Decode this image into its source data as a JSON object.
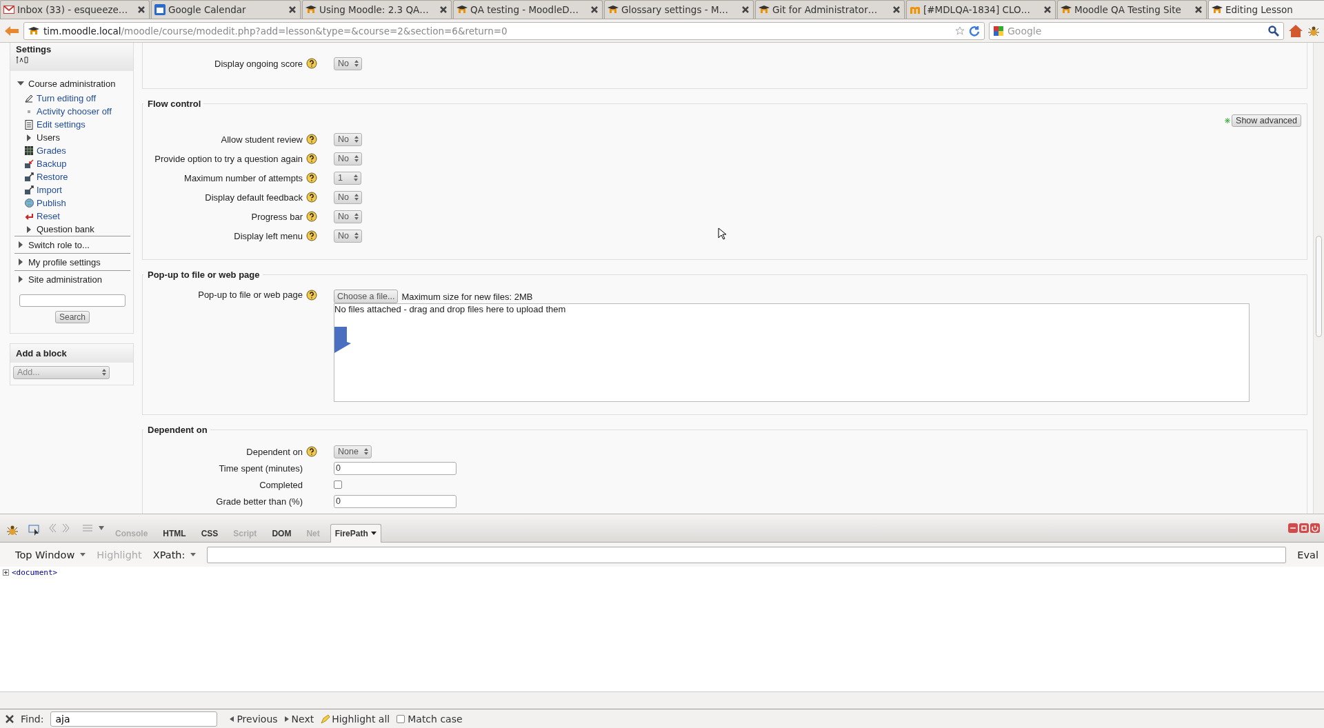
{
  "browser": {
    "tabs": [
      {
        "title": "Inbox (33) - esqueeze…",
        "kind": "mail",
        "selected": false
      },
      {
        "title": "Google Calendar",
        "kind": "calendar",
        "selected": false
      },
      {
        "title": "Using Moodle: 2.3 QA…",
        "kind": "moodle",
        "selected": false
      },
      {
        "title": "QA testing - MoodleD…",
        "kind": "moodle",
        "selected": false
      },
      {
        "title": "Glossary settings - M…",
        "kind": "moodle",
        "selected": false
      },
      {
        "title": "Git for Administrator…",
        "kind": "moodle",
        "selected": false
      },
      {
        "title": "[#MDLQA-1834] CLO…",
        "kind": "m",
        "selected": false
      },
      {
        "title": "Moodle QA Testing Site",
        "kind": "moodle",
        "selected": false
      },
      {
        "title": "Editing Lesson",
        "kind": "moodle",
        "selected": true
      }
    ],
    "url": {
      "host": "tim.moodle.local",
      "path": "/moodle/course/modedit.php?add=lesson&type=&course=2&section=6&return=0"
    },
    "search": {
      "placeholder": "Google"
    }
  },
  "sidebar": {
    "settings": {
      "title": "Settings",
      "tree": [
        {
          "label": "Course administration",
          "expanded": true,
          "children": [
            {
              "label": "Turn editing off",
              "kind": "edit"
            },
            {
              "label": "Activity chooser off",
              "kind": "dot"
            },
            {
              "label": "Edit settings",
              "kind": "doc"
            },
            {
              "label": "Users",
              "kind": "folder",
              "expanded": false
            },
            {
              "label": "Grades",
              "kind": "grid"
            },
            {
              "label": "Backup",
              "kind": "backup"
            },
            {
              "label": "Restore",
              "kind": "restore"
            },
            {
              "label": "Import",
              "kind": "restore"
            },
            {
              "label": "Publish",
              "kind": "globe"
            },
            {
              "label": "Reset",
              "kind": "reset"
            },
            {
              "label": "Question bank",
              "kind": "folder",
              "expanded": false
            }
          ]
        },
        {
          "label": "Switch role to...",
          "expanded": false
        },
        {
          "label": "My profile settings",
          "expanded": false
        },
        {
          "label": "Site administration",
          "expanded": false
        }
      ],
      "search_button": "Search"
    },
    "add_block": {
      "title": "Add a block",
      "select": "Add..."
    }
  },
  "form": {
    "sections": [
      {
        "rows": [
          {
            "label": "Display ongoing score",
            "help": true,
            "kind": "select",
            "value": "No"
          }
        ]
      },
      {
        "legend": "Flow control",
        "advanced_button": "Show advanced",
        "rows": [
          {
            "label": "Allow student review",
            "help": true,
            "kind": "select",
            "value": "No"
          },
          {
            "label": "Provide option to try a question again",
            "help": true,
            "kind": "select",
            "value": "No"
          },
          {
            "label": "Maximum number of attempts",
            "help": true,
            "kind": "select",
            "value": "1"
          },
          {
            "label": "Display default feedback",
            "help": true,
            "kind": "select",
            "value": "No"
          },
          {
            "label": "Progress bar",
            "help": true,
            "kind": "select",
            "value": "No"
          },
          {
            "label": "Display left menu",
            "help": true,
            "kind": "select",
            "value": "No"
          }
        ]
      },
      {
        "legend": "Pop-up to file or web page",
        "rows": [
          {
            "label": "Pop-up to file or web page",
            "help": true,
            "kind": "file",
            "button": "Choose a file...",
            "note": "Maximum size for new files: 2MB",
            "dropzone": "No files attached - drag and drop files here to upload them"
          }
        ]
      },
      {
        "legend": "Dependent on",
        "rows": [
          {
            "label": "Dependent on",
            "help": true,
            "kind": "select",
            "value": "None"
          },
          {
            "label": "Time spent (minutes)",
            "help": false,
            "kind": "text",
            "value": "0"
          },
          {
            "label": "Completed",
            "help": false,
            "kind": "checkbox",
            "checked": false
          },
          {
            "label": "Grade better than (%)",
            "help": false,
            "kind": "text",
            "value": "0"
          }
        ]
      }
    ]
  },
  "devtools": {
    "tabs": [
      {
        "label": "Console",
        "disabled": true,
        "selected": false
      },
      {
        "label": "HTML",
        "disabled": false,
        "selected": false
      },
      {
        "label": "CSS",
        "disabled": false,
        "selected": false
      },
      {
        "label": "Script",
        "disabled": true,
        "selected": false
      },
      {
        "label": "DOM",
        "disabled": false,
        "selected": false
      },
      {
        "label": "Net",
        "disabled": true,
        "selected": false
      },
      {
        "label": "FirePath",
        "disabled": false,
        "selected": true
      }
    ],
    "window_select": "Top Window",
    "highlight": "Highlight",
    "xpath_label": "XPath:",
    "eval": "Eval",
    "tree": [
      "<document>"
    ]
  },
  "find_bar": {
    "label": "Find:",
    "value": "aja",
    "previous": "Previous",
    "next": "Next",
    "highlight_all": "Highlight all",
    "match_case": {
      "label": "Match case",
      "checked": false
    }
  }
}
